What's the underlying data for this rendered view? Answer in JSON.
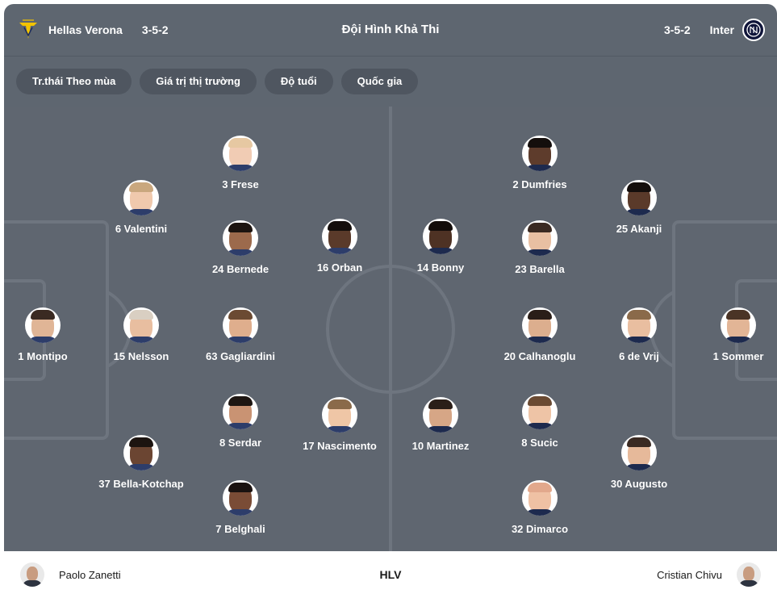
{
  "header": {
    "title": "Đội Hình Khả Thi",
    "home": {
      "name": "Hellas Verona",
      "formation": "3-5-2",
      "badge_icon": "hellas-verona-badge"
    },
    "away": {
      "name": "Inter",
      "formation": "3-5-2",
      "badge_icon": "inter-badge"
    }
  },
  "filters": [
    {
      "label": "Tr.thái Theo mùa"
    },
    {
      "label": "Giá trị thị trường"
    },
    {
      "label": "Độ tuổi"
    },
    {
      "label": "Quốc gia"
    }
  ],
  "colors": {
    "header_bg": "#5e6670",
    "pitch_bg": "#5f6670",
    "pitch_lines": "#6e757f",
    "chip_bg": "#4f5660"
  },
  "home_players": [
    {
      "label": "1 Montipo",
      "skin": "#e0b596",
      "hair": "#3a2a22",
      "shirt": "#2d3d6a"
    },
    {
      "label": "6 Valentini",
      "skin": "#f0c9ad",
      "hair": "#c9a77e",
      "shirt": "#2d3d6a"
    },
    {
      "label": "15 Nelsson",
      "skin": "#e8bea0",
      "hair": "#d9cfc2",
      "shirt": "#2d3d6a"
    },
    {
      "label": "37 Bella-Kotchap",
      "skin": "#6b4532",
      "hair": "#1c1410",
      "shirt": "#2d3d6a"
    },
    {
      "label": "3 Frese",
      "skin": "#f1ccb4",
      "hair": "#e6c8a2",
      "shirt": "#2d3d6a"
    },
    {
      "label": "24 Bernede",
      "skin": "#9c6a4c",
      "hair": "#1c1410",
      "shirt": "#2d3d6a"
    },
    {
      "label": "63 Gagliardini",
      "skin": "#dfae8d",
      "hair": "#6b4a32",
      "shirt": "#2d3d6a"
    },
    {
      "label": "8 Serdar",
      "skin": "#c99373",
      "hair": "#1e1612",
      "shirt": "#2d3d6a"
    },
    {
      "label": "7 Belghali",
      "skin": "#7a4c36",
      "hair": "#1a1210",
      "shirt": "#2d3d6a"
    },
    {
      "label": "16 Orban",
      "skin": "#5a3a2a",
      "hair": "#140e0c",
      "shirt": "#2d3d6a"
    },
    {
      "label": "17 Nascimento",
      "skin": "#efc6a6",
      "hair": "#8a6a4a",
      "shirt": "#2d3d6a"
    }
  ],
  "away_players": [
    {
      "label": "1 Sommer",
      "skin": "#e2b596",
      "hair": "#4a3426",
      "shirt": "#1d2a4e"
    },
    {
      "label": "25 Akanji",
      "skin": "#5a3a2a",
      "hair": "#140e0c",
      "shirt": "#1d2a4e"
    },
    {
      "label": "6 de Vrij",
      "skin": "#e9bea0",
      "hair": "#8a6a4a",
      "shirt": "#1d2a4e"
    },
    {
      "label": "30 Augusto",
      "skin": "#e6b99a",
      "hair": "#3a2a22",
      "shirt": "#1d2a4e"
    },
    {
      "label": "2 Dumfries",
      "skin": "#5e3c2c",
      "hair": "#140e0c",
      "shirt": "#1d2a4e"
    },
    {
      "label": "23 Barella",
      "skin": "#e8bfa2",
      "hair": "#3a2a22",
      "shirt": "#1d2a4e"
    },
    {
      "label": "20 Calhanoglu",
      "skin": "#dcae8e",
      "hair": "#2a1e18",
      "shirt": "#1d2a4e"
    },
    {
      "label": "8 Sucic",
      "skin": "#eec4a6",
      "hair": "#6a4a32",
      "shirt": "#1d2a4e"
    },
    {
      "label": "32 Dimarco",
      "skin": "#efc1a4",
      "hair": "#e2a88c",
      "shirt": "#1d2a4e"
    },
    {
      "label": "14 Bonny",
      "skin": "#4e3224",
      "hair": "#120c0a",
      "shirt": "#1d2a4e"
    },
    {
      "label": "10 Martinez",
      "skin": "#d6a686",
      "hair": "#2a1e18",
      "shirt": "#1d2a4e"
    }
  ],
  "footer": {
    "home_coach": "Paolo Zanetti",
    "center_label": "HLV",
    "away_coach": "Cristian Chivu"
  }
}
